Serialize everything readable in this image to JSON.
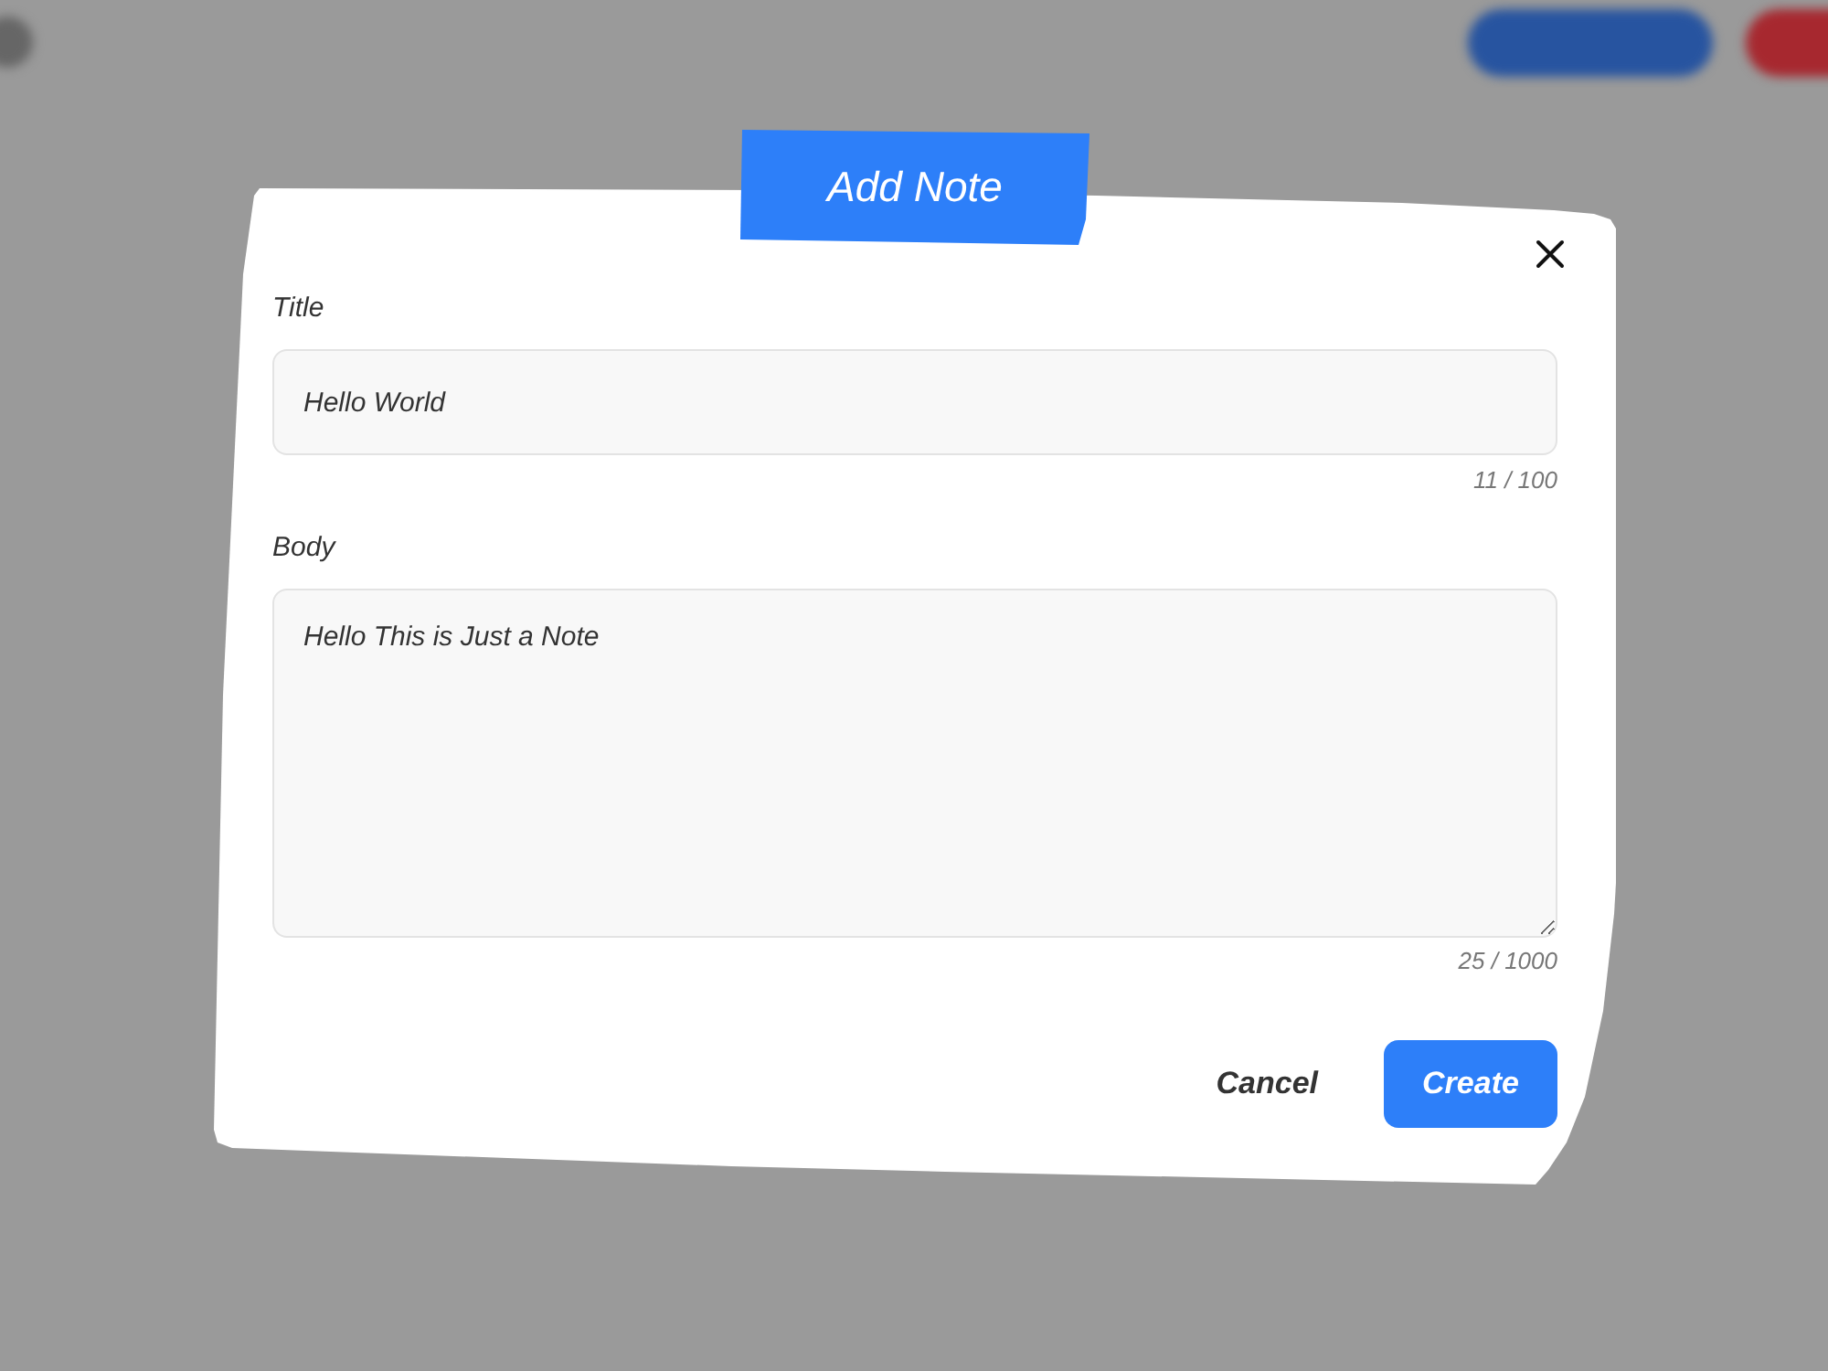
{
  "dialog": {
    "title": "Add Note",
    "fields": [
      {
        "kind": "text",
        "label": "Title",
        "value": "Hello World",
        "counter": "11 / 100"
      },
      {
        "kind": "textarea",
        "label": "Body",
        "value": "Hello This is Just a Note",
        "counter": "25 / 1000"
      }
    ],
    "buttons": [
      {
        "kind": "secondary",
        "label": "Cancel"
      },
      {
        "kind": "primary",
        "label": "Create"
      }
    ]
  }
}
